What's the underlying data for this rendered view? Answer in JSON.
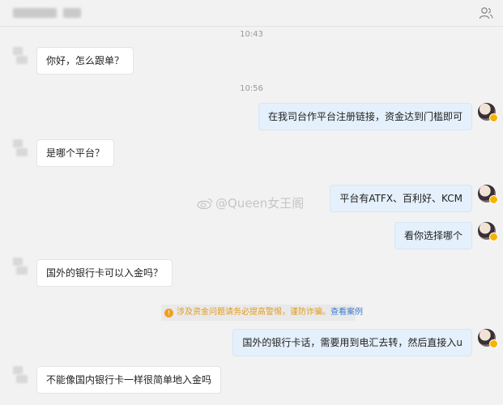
{
  "header": {
    "title": "",
    "icons": {
      "contacts": "people-icon"
    }
  },
  "messages": [
    {
      "type": "time",
      "text": "10:43"
    },
    {
      "type": "in",
      "text": "你好，怎么跟单？"
    },
    {
      "type": "time",
      "text": "10:56"
    },
    {
      "type": "out",
      "text": "在我司台作平台注册链接，资金达到门槛即可"
    },
    {
      "type": "in",
      "text": "是哪个平台？"
    },
    {
      "type": "out",
      "text": "平台有ATFX、百利好、KCM"
    },
    {
      "type": "out",
      "text": "看你选择哪个"
    },
    {
      "type": "in",
      "text": "国外的银行卡可以入金吗？"
    },
    {
      "type": "out",
      "text": "国外的银行卡话，需要用到电汇去转，然后直接入u"
    },
    {
      "type": "in",
      "text": "不能像国内银行卡一样很简单地入金吗"
    }
  ],
  "notice": {
    "text": "涉及资金问题请务必提高警惕，谨防诈骗。",
    "link": "查看案例",
    "icon": "warning-icon",
    "color": "#e39a1a"
  },
  "watermark": "@Queen女王阁",
  "colors": {
    "outgoing_bubble": "#e4f0fb",
    "incoming_bubble": "#ffffff",
    "background": "#f2f2f2"
  }
}
